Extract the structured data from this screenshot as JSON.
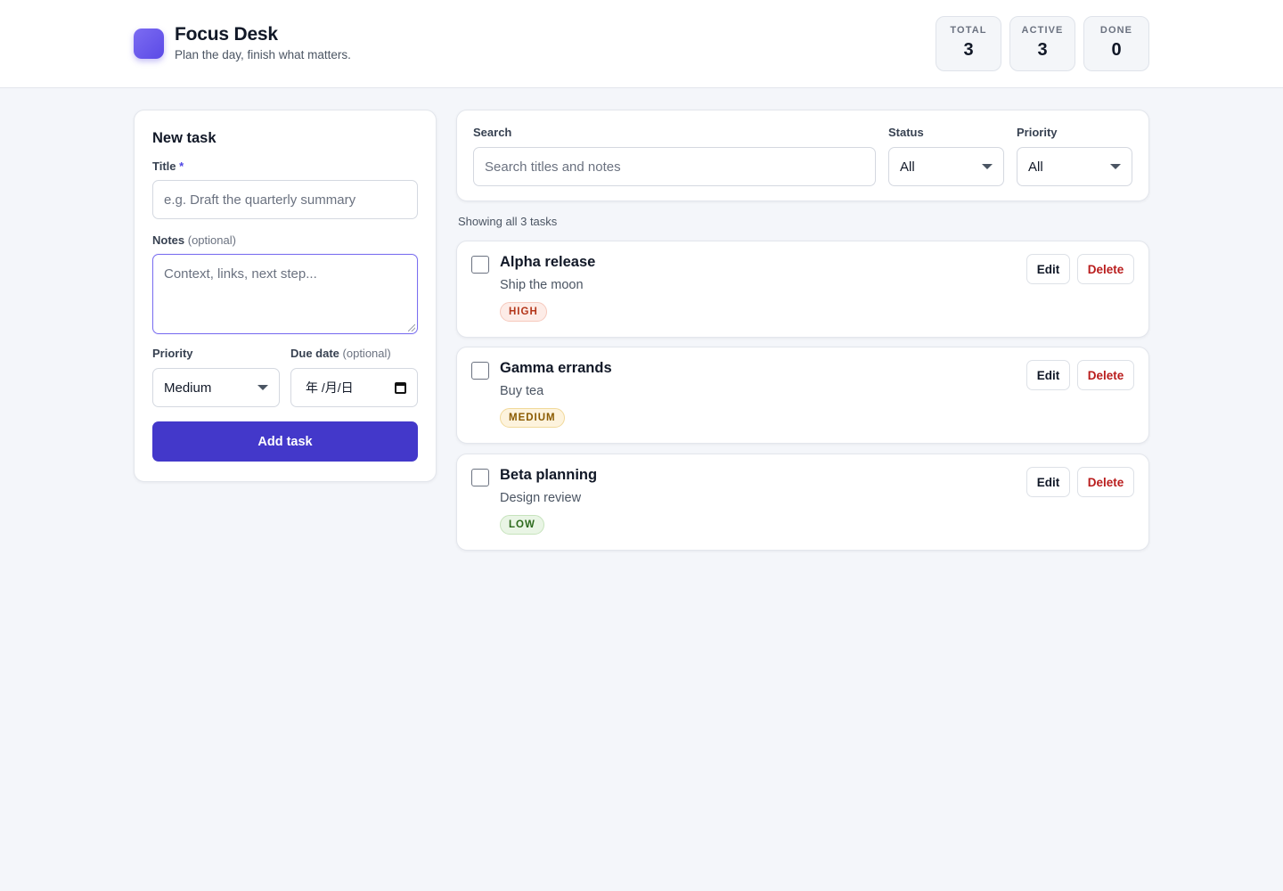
{
  "header": {
    "title": "Focus Desk",
    "subtitle": "Plan the day, finish what matters.",
    "stats": [
      {
        "label": "TOTAL",
        "value": "3"
      },
      {
        "label": "ACTIVE",
        "value": "3"
      },
      {
        "label": "DONE",
        "value": "0"
      }
    ]
  },
  "new_task": {
    "heading": "New task",
    "title_label": "Title",
    "title_required": "*",
    "title_placeholder": "e.g. Draft the quarterly summary",
    "notes_label": "Notes",
    "notes_optional": "(optional)",
    "notes_placeholder": "Context, links, next step...",
    "priority_label": "Priority",
    "priority_value": "Medium",
    "due_label": "Due date",
    "due_optional": "(optional)",
    "due_value": "年 /月/日",
    "add_button": "Add task"
  },
  "filters": {
    "search_label": "Search",
    "search_placeholder": "Search titles and notes",
    "status_label": "Status",
    "status_value": "All",
    "priority_label": "Priority",
    "priority_value": "All"
  },
  "showing_text": "Showing all 3 tasks",
  "tasks": [
    {
      "title": "Alpha release",
      "note": "Ship the moon",
      "priority": "HIGH",
      "edit": "Edit",
      "delete": "Delete"
    },
    {
      "title": "Gamma errands",
      "note": "Buy tea",
      "priority": "MEDIUM",
      "edit": "Edit",
      "delete": "Delete"
    },
    {
      "title": "Beta planning",
      "note": "Design review",
      "priority": "LOW",
      "edit": "Edit",
      "delete": "Delete"
    }
  ],
  "colors": {
    "accent": "#4338ca",
    "background": "#f4f6fa",
    "delete": "#b91c1c"
  }
}
